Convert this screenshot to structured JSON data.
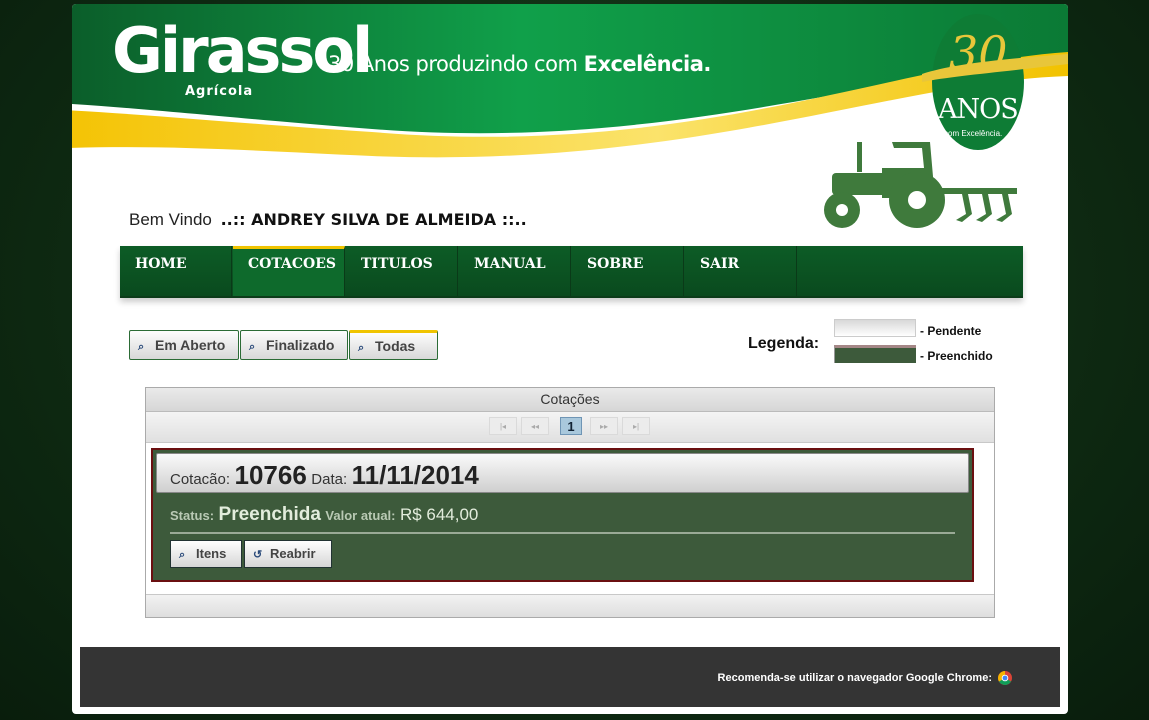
{
  "brand": {
    "name": "Girassol",
    "sub": "Agrícola",
    "tagline_pre": "30 Anos produzindo com",
    "tagline_bold": "Excelência.",
    "badge_number": "30",
    "badge_word": "ANOS",
    "badge_sub": "com Excelência."
  },
  "welcome": {
    "label": "Bem Vindo",
    "user": "..:: ANDREY SILVA DE ALMEIDA ::.."
  },
  "nav": {
    "items": [
      {
        "label": "HOME"
      },
      {
        "label": "COTACOES"
      },
      {
        "label": "TITULOS"
      },
      {
        "label": "MANUAL"
      },
      {
        "label": "SOBRE"
      },
      {
        "label": "SAIR"
      }
    ],
    "active_index": 1
  },
  "filters": {
    "open": "Em Aberto",
    "finished": "Finalizado",
    "all": "Todas"
  },
  "legend": {
    "title": "Legenda:",
    "pending": "- Pendente",
    "filled": "- Preenchido"
  },
  "panel": {
    "title": "Cotações",
    "pager": {
      "first": "|◂",
      "prev": "◂◂",
      "current": "1",
      "next": "▸▸",
      "last": "▸|"
    },
    "card": {
      "quote_label": "Cotacão:",
      "quote_number": "10766",
      "date_label": "Data:",
      "date_value": "11/11/2014",
      "status_label": "Status:",
      "status_value": "Preenchida",
      "value_label": "Valor atual:",
      "value_amount": "R$ 644,00",
      "btn_items": "Itens",
      "btn_reopen": "Reabrir"
    }
  },
  "footer": {
    "text": "Recomenda-se utilizar o navegador Google Chrome:"
  },
  "colors": {
    "brand_green": "#0a4a1e",
    "accent_yellow": "#f0c400",
    "card_green": "#3d5a3b",
    "card_border": "#6a0f10"
  }
}
